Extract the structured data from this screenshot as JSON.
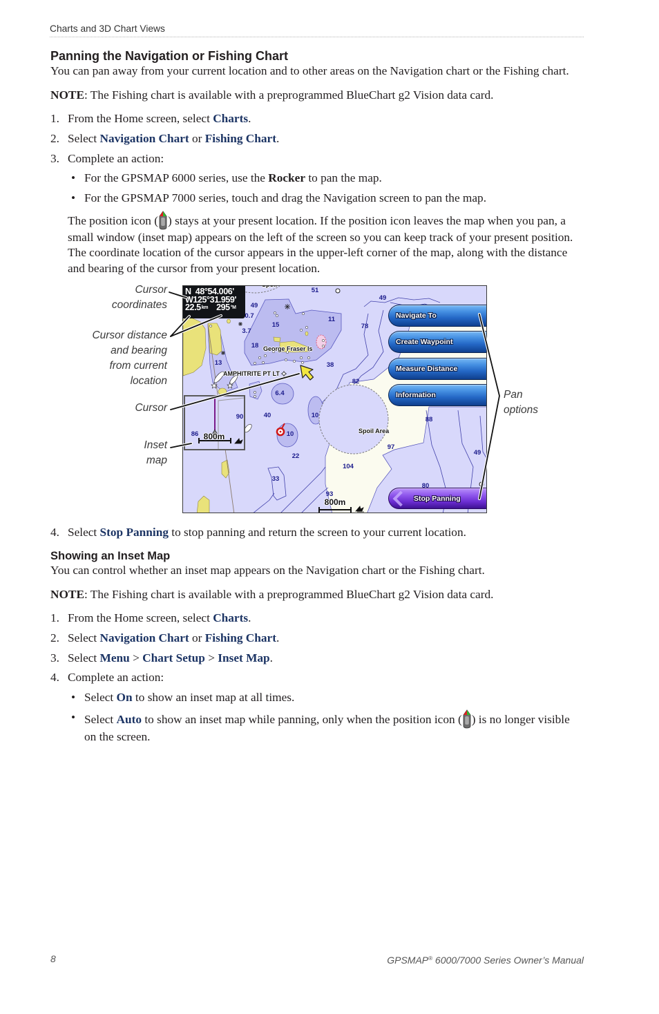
{
  "header": {
    "section_title": "Charts and 3D Chart Views"
  },
  "panning": {
    "title": "Panning the Navigation or Fishing Chart",
    "intro": "You can pan away from your current location and to other areas on the Navigation chart or the Fishing chart.",
    "note": {
      "label": "NOTE",
      "text": ": The Fishing chart is available with a preprogrammed BlueChart g2 Vision data card."
    },
    "steps": [
      {
        "num": "1.",
        "pre": "From the Home screen, select ",
        "key1": "Charts",
        "post": "."
      },
      {
        "num": "2.",
        "pre": "Select ",
        "key1": "Navigation Chart",
        "mid": " or ",
        "key2": "Fishing Chart",
        "post": "."
      },
      {
        "num": "3.",
        "pre": "Complete an action:"
      },
      {
        "num": "4.",
        "pre": "Select ",
        "key1": "Stop Panning",
        "post": " to stop panning and return the screen to your current location."
      }
    ],
    "bullets": [
      {
        "pre": "For the GPSMAP 6000 series, use the ",
        "strong": "Rocker",
        "post": " to pan the map."
      },
      {
        "pre": "For the GPSMAP 7000 series, touch and drag the Navigation screen to pan the map."
      }
    ],
    "position_note": {
      "pre": "The position icon (",
      "post": ") stays at your present location. If the position icon leaves the map when you pan, a small window (inset map) appears on the left of the screen so you can keep track of your present position. The coordinate location of the cursor appears in the upper-left corner of the map, along with the distance and bearing of the cursor from your present location."
    }
  },
  "figure": {
    "callouts": {
      "cursor_coordinates": "Cursor coordinates",
      "cursor_distance_bearing": "Cursor distance and bearing from current location",
      "cursor": "Cursor",
      "inset_map": "Inset map",
      "pan_options": "Pan options"
    },
    "cursor_readout": {
      "latitude": "N  48°54.006'",
      "longitude": "W125°31.959'",
      "distance": "22.5",
      "distance_unit": "km",
      "bearing": "295",
      "bearing_unit": "°M"
    },
    "pan_menu": [
      "Navigate To",
      "Create Waypoint",
      "Measure Distance",
      "Information"
    ],
    "stop_panning": "Stop Panning",
    "map_labels": {
      "island": "George Fraser Is",
      "lighthouse": "AMPHITRITE PT LT",
      "spoil_area": "Spoil Area",
      "spoil_top": "Spoil"
    },
    "soundings": [
      "51",
      "49",
      "49",
      "0.7",
      "15",
      "3.7",
      "11",
      "78",
      "18",
      "13",
      "38",
      "82",
      "6.4",
      "40",
      "10",
      "88",
      "10",
      "97",
      "49",
      "22",
      "104",
      "33",
      "80",
      "93"
    ],
    "scale": "800m",
    "inset": {
      "soundings": [
        "86",
        "90"
      ],
      "scale": "800m"
    },
    "colors": {
      "water": "#d8d8fb",
      "deep_water": "#fbfbef",
      "shallow": "#bcbcf0",
      "land": "#e9e27a",
      "menu_button": "#2366c4",
      "stop_button": "#6a2cd0"
    }
  },
  "inset_section": {
    "title": "Showing an Inset Map",
    "intro": "You can control whether an inset map appears on the Navigation chart or the Fishing chart.",
    "note": {
      "label": "NOTE",
      "text": ": The Fishing chart is available with a preprogrammed BlueChart g2 Vision data card."
    },
    "steps": [
      {
        "num": "1.",
        "pre": "From the Home screen, select ",
        "key1": "Charts",
        "post": "."
      },
      {
        "num": "2.",
        "pre": "Select ",
        "key1": "Navigation Chart",
        "mid": " or ",
        "key2": "Fishing Chart",
        "post": "."
      },
      {
        "num": "3.",
        "pre": "Select ",
        "key1": "Menu",
        "mid": " > ",
        "key2": "Chart Setup",
        "mid2": " > ",
        "key3": "Inset Map",
        "post": "."
      },
      {
        "num": "4.",
        "pre": "Complete an action:"
      }
    ],
    "bullets": [
      {
        "pre": "Select ",
        "key1": "On",
        "post": " to show an inset map at all times."
      },
      {
        "pre": "Select ",
        "key1": "Auto",
        "mid": " to show an inset map while panning, only when the position icon (",
        "post": ") is no longer visible on the screen."
      }
    ]
  },
  "footer": {
    "page_number": "8",
    "manual_brand": "GPSMAP",
    "registered": "®",
    "manual_title": " 6000/7000 Series Owner’s Manual"
  }
}
